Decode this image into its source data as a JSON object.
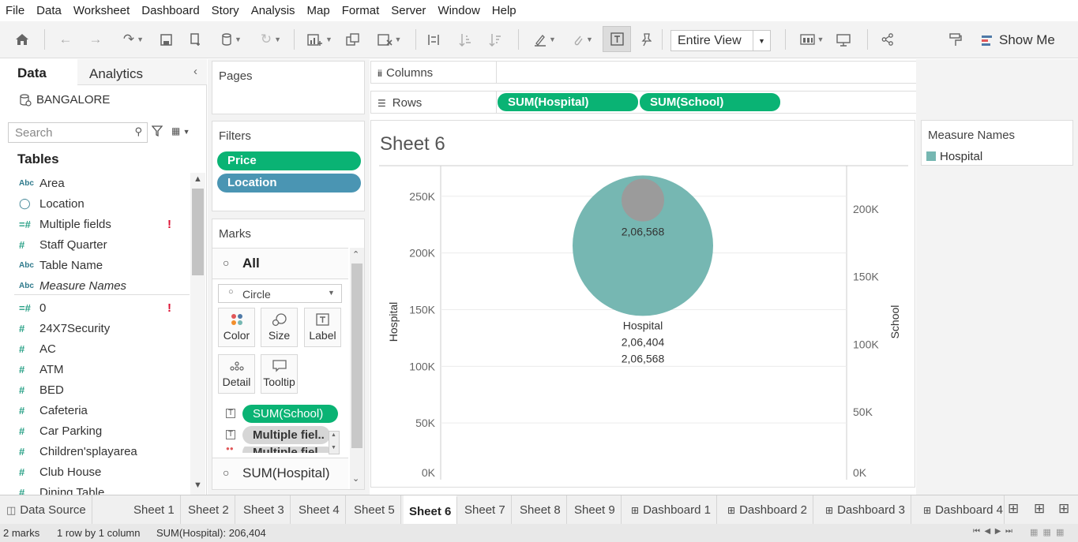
{
  "menu": [
    "File",
    "Data",
    "Worksheet",
    "Dashboard",
    "Story",
    "Analysis",
    "Map",
    "Format",
    "Server",
    "Window",
    "Help"
  ],
  "toolbar": {
    "view_select": "Entire View",
    "show_me": "Show Me"
  },
  "data_pane": {
    "tab_data": "Data",
    "tab_analytics": "Analytics",
    "datasource": "BANGALORE",
    "search_placeholder": "Search",
    "tables_header": "Tables",
    "fields": [
      {
        "icon": "Abc",
        "name": "Area"
      },
      {
        "icon": "globe",
        "name": "Location"
      },
      {
        "icon": "#",
        "name": "Multiple fields",
        "warn": "!"
      },
      {
        "icon": "#",
        "name": "Staff Quarter"
      },
      {
        "icon": "Abc",
        "name": "Table Name"
      },
      {
        "icon": "Abc",
        "name": "Measure Names"
      },
      {
        "icon": "#",
        "name": "0",
        "warn": "!"
      },
      {
        "icon": "#",
        "name": "24X7Security"
      },
      {
        "icon": "#",
        "name": "AC"
      },
      {
        "icon": "#",
        "name": "ATM"
      },
      {
        "icon": "#",
        "name": "BED"
      },
      {
        "icon": "#",
        "name": "Cafeteria"
      },
      {
        "icon": "#",
        "name": "Car Parking"
      },
      {
        "icon": "#",
        "name": "Children'splayarea"
      },
      {
        "icon": "#",
        "name": "Club House"
      },
      {
        "icon": "#",
        "name": "Dining Table"
      }
    ]
  },
  "pages": {
    "header": "Pages"
  },
  "filters": {
    "header": "Filters",
    "pills": [
      "Price",
      "Location"
    ]
  },
  "marks": {
    "header": "Marks",
    "all_label": "All",
    "mark_type": "Circle",
    "buttons": [
      "Color",
      "Size",
      "Label",
      "Detail",
      "Tooltip"
    ],
    "pills": [
      "SUM(School)",
      "Multiple fiel..",
      "Multiple fiel.."
    ],
    "bottom": "SUM(Hospital)"
  },
  "shelves": {
    "columns_label": "Columns",
    "rows_label": "Rows",
    "rows_pills": [
      "SUM(Hospital)",
      "SUM(School)"
    ]
  },
  "sheet": {
    "title": "Sheet 6"
  },
  "legend": {
    "title": "Measure Names",
    "items": [
      {
        "label": "Hospital",
        "color": "#76b7b2"
      }
    ]
  },
  "chart_data": {
    "type": "scatter",
    "left_axis": {
      "label": "Hospital",
      "ticks": [
        "0K",
        "50K",
        "100K",
        "150K",
        "200K",
        "250K"
      ],
      "range": [
        0,
        277000
      ]
    },
    "right_axis": {
      "label": "School",
      "ticks": [
        "0K",
        "50K",
        "100K",
        "150K",
        "200K"
      ],
      "range": [
        0,
        232000
      ]
    },
    "marks": [
      {
        "series": "Hospital",
        "value": 206404,
        "color": "#76b7b2",
        "labels": [
          "Hospital",
          "2,06,404",
          "2,06,568"
        ]
      },
      {
        "series": "School",
        "value": 206568,
        "color": "#9b9b9b",
        "labels": [
          "2,06,568"
        ]
      }
    ]
  },
  "sheet_tabs": {
    "items": [
      "Data Source",
      "Sheet 1",
      "Sheet 2",
      "Sheet 3",
      "Sheet 4",
      "Sheet 5",
      "Sheet 6",
      "Sheet 7",
      "Sheet 8",
      "Sheet 9",
      "Dashboard 1",
      "Dashboard 2",
      "Dashboard 3",
      "Dashboard 4"
    ],
    "active": "Sheet 6"
  },
  "status": {
    "marks": "2 marks",
    "dims": "1 row by 1 column",
    "sum": "SUM(Hospital): 206,404"
  }
}
